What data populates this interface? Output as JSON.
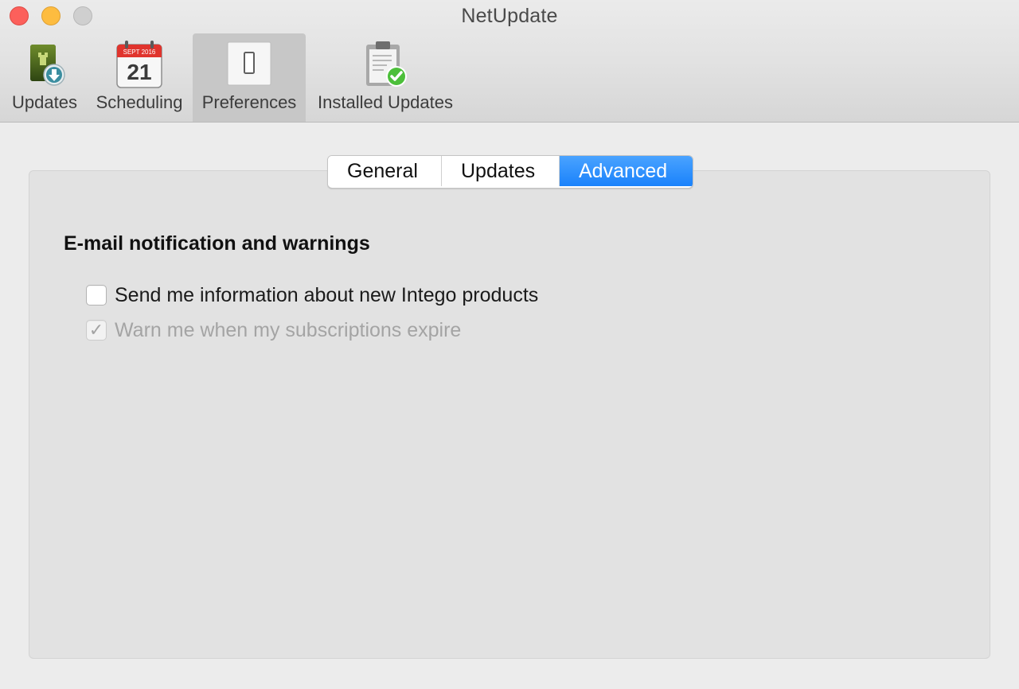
{
  "window": {
    "title": "NetUpdate"
  },
  "toolbar": {
    "items": [
      {
        "label": "Updates",
        "icon": "tower-download-icon"
      },
      {
        "label": "Scheduling",
        "icon": "calendar-icon",
        "calendar_month": "SEPT 2016",
        "calendar_day": "21"
      },
      {
        "label": "Preferences",
        "icon": "switch-icon",
        "selected": true
      },
      {
        "label": "Installed Updates",
        "icon": "clipboard-check-icon"
      }
    ]
  },
  "tabs": {
    "items": [
      "General",
      "Updates",
      "Advanced"
    ],
    "active": "Advanced"
  },
  "advanced": {
    "section_title": "E-mail notification and warnings",
    "options": [
      {
        "label": "Send me information about new Intego products",
        "checked": false,
        "enabled": true
      },
      {
        "label": "Warn me when my subscriptions expire",
        "checked": true,
        "enabled": false
      }
    ]
  },
  "colors": {
    "accent": "#1a82fb",
    "close": "#fc605b",
    "minimize": "#fdbc40",
    "zoom_disabled": "#cfcfcf",
    "disabled_text": "#a4a4a4"
  }
}
